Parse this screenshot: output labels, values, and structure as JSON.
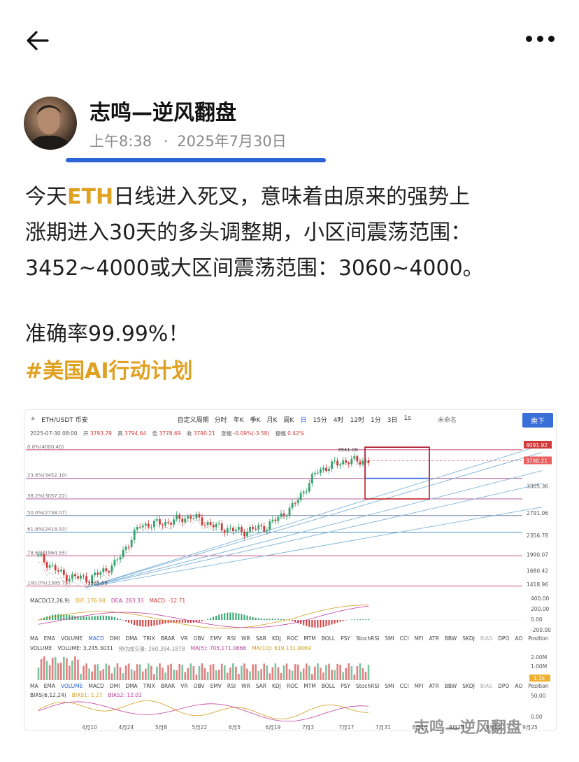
{
  "post": {
    "author": "志鸣—逆风翻盘",
    "time": "上午8:38",
    "separator": "·",
    "date": "2025年7月30日",
    "line1_pre": "今天",
    "line1_eth": "ETH",
    "line1_post": "日线进入死叉，意味着由原来的强势上",
    "line2": "涨期进入30天的多头调整期，小区间震荡范围：",
    "line3": "3452~4000或大区间震荡范围：3060~4000。",
    "accuracy": "准确率99.99%！",
    "hashtag": "#美国AI行动计划"
  },
  "icons": {
    "back": "back-arrow-icon",
    "more": "more-dots-icon"
  },
  "chart_toolbar": {
    "symbol": "ETH/USDT 币安",
    "custom": "自定义周期",
    "periods": [
      "分时",
      "年K",
      "季K",
      "月K",
      "周K",
      "日",
      "15分",
      "4时",
      "12时",
      "1分",
      "3日",
      "1s"
    ],
    "selected_period": "日",
    "unnamed": "未命名",
    "sell": "卖下"
  },
  "ohlc": {
    "date": "2025-07-30 08:00",
    "open_label": "开",
    "open": "3793.79",
    "high_label": "高",
    "high": "3794.64",
    "low_label": "低",
    "low": "3778.69",
    "close_label": "收",
    "close": "3790.21",
    "change_label": "涨幅",
    "change": "-0.09%(-3.58)",
    "amp_label": "振幅",
    "amp": "0.42%"
  },
  "fib_levels": [
    {
      "label": "0.0%(4000.40)",
      "price": 4000.4,
      "color": "#c0306a"
    },
    {
      "label": "23.6%(3452.10)",
      "price": 3452.1,
      "color": "#b45fa0"
    },
    {
      "label": "38.2%(3057.22)",
      "price": 3057.22,
      "color": "#b45fa0"
    },
    {
      "label": "50.0%(2738.07)",
      "price": 2738.07,
      "color": "#7080a0"
    },
    {
      "label": "61.8%(2418.93)",
      "price": 2418.93,
      "color": "#4a90c0"
    },
    {
      "label": "78.6%(1964.55)",
      "price": 1964.55,
      "color": "#c0306a"
    },
    {
      "label": "100.0%(1385.75)",
      "price": 1385.75,
      "color": "#c0306a"
    }
  ],
  "price_axis": [
    "4091.92",
    "3790.21",
    "3305.36",
    "2791.06",
    "2356.78",
    "1990.07",
    "1680.42",
    "1418.96"
  ],
  "annotations": {
    "high": "3941.00",
    "low": "1385.05"
  },
  "macd": {
    "label": "MACD(12,26,9)",
    "dif": "DIF: 276.98",
    "dea": "DEA: 283.33",
    "macd": "MACD: -12.71",
    "axis": [
      "400.00",
      "200.00",
      "0.00",
      "-200.00"
    ]
  },
  "indicators_row": [
    "MA",
    "EMA",
    "VOLUME",
    "MACD",
    "DMI",
    "DMA",
    "TRIX",
    "BRAR",
    "VR",
    "OBV",
    "EMV",
    "RSI",
    "WR",
    "SAR",
    "KDJ",
    "ROC",
    "MTM",
    "BOLL",
    "PSY",
    "StochRSI",
    "SMI",
    "CCI",
    "MFI",
    "ATR",
    "BBW",
    "SKDJ",
    "BIAS",
    "DPO",
    "AO",
    "Position"
  ],
  "volume": {
    "label": "VOLUME",
    "value": "VOLUME: 3,245.3031",
    "est": "预估成交量: 260,394.1878",
    "ma5": "MA(5): 705,171.0666",
    "ma10": "MA(10): 619,131.9069",
    "axis": [
      "2.00M",
      "1.00M"
    ],
    "last": "1.1k"
  },
  "bias": {
    "label": "BIAS(6,12,24)",
    "b1": "BIAS1: 1.27",
    "b2": "BIAS2: 12.01",
    "axis": [
      "50.00",
      "0.00"
    ]
  },
  "x_axis": [
    "4月10",
    "4月24",
    "5月8",
    "5月22",
    "6月5",
    "6月19",
    "7月3",
    "7月17",
    "7月31",
    "8月14",
    "8月28",
    "9月11",
    "9月25"
  ],
  "watermark": "志鸣—逆风翻盘",
  "chart_data": {
    "type": "candlestick",
    "title": "ETH/USDT 币安",
    "x": [
      "4月10",
      "4月24",
      "5月8",
      "5月22",
      "6月5",
      "6月19",
      "7月3",
      "7月17",
      "7月31"
    ],
    "series": [
      {
        "values": [
          1580,
          1790,
          2500,
          2620,
          2560,
          2420,
          2530,
          3720,
          3790
        ]
      }
    ],
    "ylim": [
      1385,
      4091
    ]
  }
}
